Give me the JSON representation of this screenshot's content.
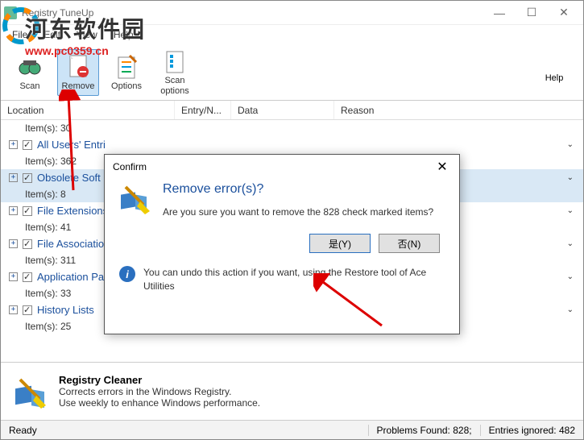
{
  "window": {
    "title": "Registry TuneUp"
  },
  "menu": {
    "file": "File",
    "edit": "Edit",
    "view": "View",
    "help": "Help"
  },
  "toolbar": {
    "scan": "Scan",
    "remove": "Remove",
    "options": "Options",
    "scan_options": "Scan\noptions",
    "help": "Help"
  },
  "columns": {
    "location": "Location",
    "entry": "Entry/N...",
    "data": "Data",
    "reason": "Reason"
  },
  "tree": {
    "items": [
      {
        "label": "",
        "count": "Item(s): 30"
      },
      {
        "label": "All Users' Entri",
        "count": "Item(s): 362"
      },
      {
        "label": "Obsolete Soft",
        "count": "Item(s): 8"
      },
      {
        "label": "File Extensions",
        "count": "Item(s): 41"
      },
      {
        "label": "File Associatio",
        "count": "Item(s): 311"
      },
      {
        "label": "Application Pa",
        "count": "Item(s): 33"
      },
      {
        "label": "History Lists",
        "count": "Item(s): 25"
      }
    ]
  },
  "dialog": {
    "title": "Confirm",
    "heading": "Remove error(s)?",
    "message": "Are you sure you want to remove the 828 check marked items?",
    "yes": "是(Y)",
    "no": "否(N)",
    "info": "You can undo this action if you want, using the Restore tool of Ace Utilities"
  },
  "footer": {
    "title": "Registry Cleaner",
    "line1": "Corrects errors in the Windows Registry.",
    "line2": "Use weekly to enhance Windows performance."
  },
  "status": {
    "left": "Ready",
    "found": "Problems Found: 828;",
    "ignored": "Entries ignored: 482"
  },
  "watermark": {
    "text": "河东软件园",
    "url": "www.pc0359.cn"
  }
}
